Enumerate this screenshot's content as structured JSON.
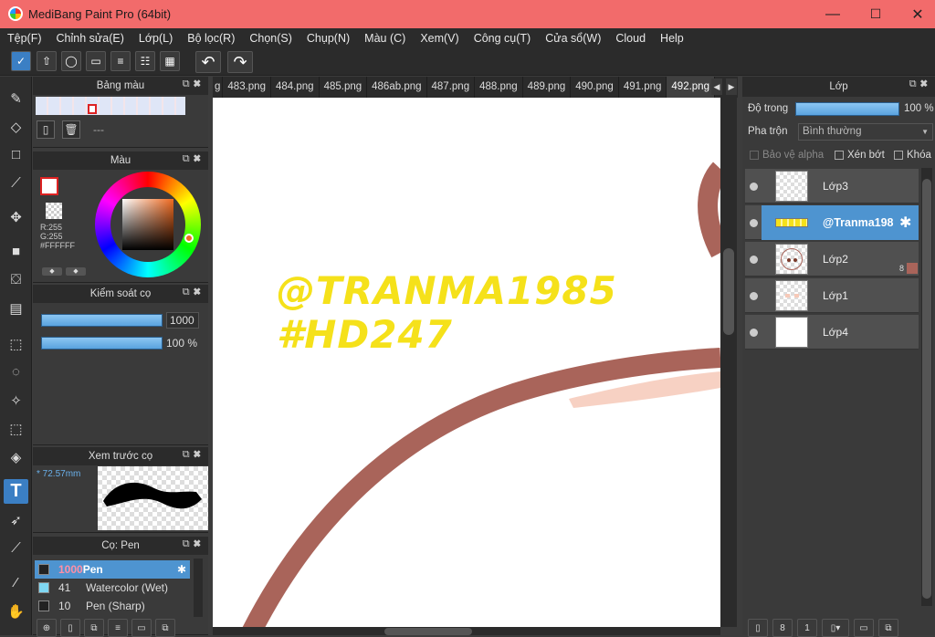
{
  "window": {
    "title": "MediBang Paint Pro (64bit)",
    "minimize": "—",
    "maximize": "☐",
    "close": "✕"
  },
  "menu": [
    "Tệp(F)",
    "Chỉnh sửa(E)",
    "Lớp(L)",
    "Bộ lọc(R)",
    "Chọn(S)",
    "Chụp(N)",
    "Màu (C)",
    "Xem(V)",
    "Công cụ(T)",
    "Cửa sổ(W)",
    "Cloud",
    "Help"
  ],
  "tabs": [
    "483.png",
    "484.png",
    "485.png",
    "486ab.png",
    "487.png",
    "488.png",
    "489.png",
    "490.png",
    "491.png",
    "492.png"
  ],
  "tabs_prefix": "g",
  "palette_panel": {
    "title": "Bảng màu",
    "dash": "---"
  },
  "color_panel": {
    "title": "Màu",
    "r": "R:255",
    "g": "G:255",
    "hex": "#FFFFFF"
  },
  "brush_control": {
    "title": "Kiểm soát cọ",
    "size": "1000",
    "opacity": "100 %"
  },
  "brush_preview": {
    "title": "Xem trước cọ",
    "size": "* 72.57mm"
  },
  "brush_panel": {
    "title": "Cọ: Pen",
    "items": [
      {
        "size": "1000",
        "name": "Pen",
        "swatch": "#222222"
      },
      {
        "size": "41",
        "name": "Watercolor (Wet)",
        "swatch": "#7fd7f2"
      },
      {
        "size": "10",
        "name": "Pen (Sharp)",
        "swatch": "#222222"
      }
    ]
  },
  "canvas_text": {
    "line1": "@TRANMA1985",
    "line2": "#HD247",
    "color": "#f5e11a"
  },
  "layer_panel": {
    "title": "Lớp",
    "opacity_label": "Độ trong",
    "opacity_value": "100 %",
    "blend_label": "Pha trộn",
    "blend_value": "Bình thường",
    "checks": [
      "Bảo vệ alpha",
      "Xén bớt",
      "Khóa"
    ],
    "layers": [
      {
        "name": "Lớp3"
      },
      {
        "name": "@Tranma198"
      },
      {
        "name": "Lớp2",
        "badge": "8"
      },
      {
        "name": "Lớp1"
      },
      {
        "name": "Lớp4"
      }
    ]
  },
  "colors": {
    "accent": "#4e94d0",
    "titlebar": "#f26b6b",
    "stroke": "#a9645a"
  }
}
